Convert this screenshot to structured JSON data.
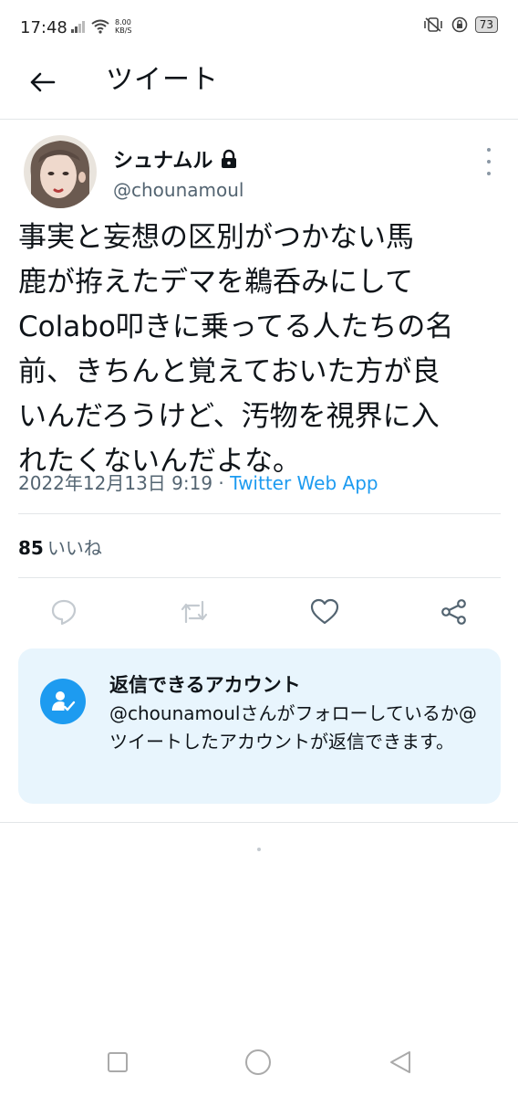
{
  "status_bar": {
    "time": "17:48",
    "net_speed_value": "8.00",
    "net_speed_unit": "KB/S",
    "battery": "73"
  },
  "header": {
    "title": "ツイート"
  },
  "tweet": {
    "author_name": "シュナムル",
    "author_handle": "@chounamoul",
    "text": "事実と妄想の区別がつかない馬\n鹿が拵えたデマを鵜呑みにして\nColabo叩きに乗ってる人たちの名\n前、きちんと覚えておいた方が良\nいんだろうけど、汚物を視界に入\nれたくないんだよな。",
    "date": "2022年12月13日 9:19",
    "separator": " · ",
    "source": "Twitter Web App",
    "likes_count": "85",
    "likes_label": "いいね"
  },
  "reply_notice": {
    "title": "返信できるアカウント",
    "description": "@chounamoulさんがフォローしているか@ツイートしたアカウントが返信できます。"
  },
  "colors": {
    "accent": "#1d9bf0",
    "secondary_text": "#536471",
    "reply_box_bg": "#e8f5fd"
  },
  "icons": [
    "back-arrow-icon",
    "lock-icon",
    "more-icon",
    "reply-icon",
    "retweet-icon",
    "like-icon",
    "share-icon",
    "person-check-icon",
    "nav-recent-icon",
    "nav-home-icon",
    "nav-back-icon"
  ]
}
